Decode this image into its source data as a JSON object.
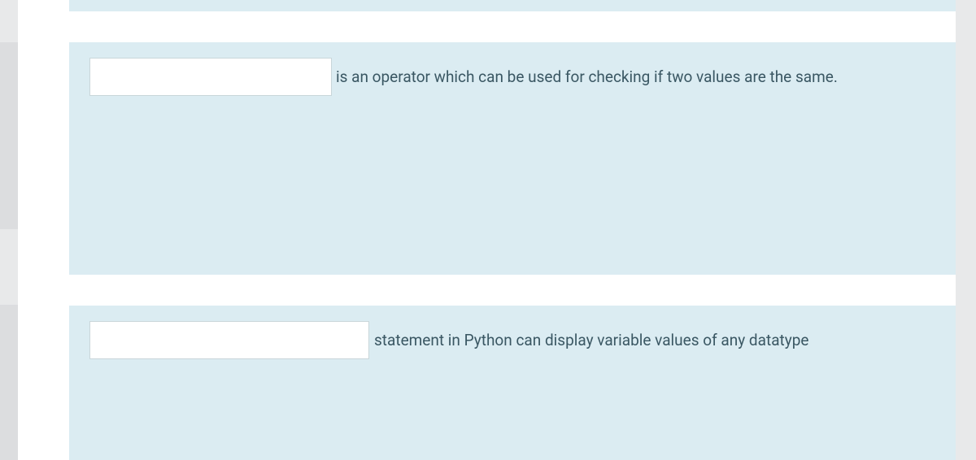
{
  "questions": [
    {
      "input_value": "",
      "text": "is an operator which can be used for checking if two values are the same."
    },
    {
      "input_value": "",
      "text": "statement in Python can display variable values of any datatype"
    }
  ]
}
